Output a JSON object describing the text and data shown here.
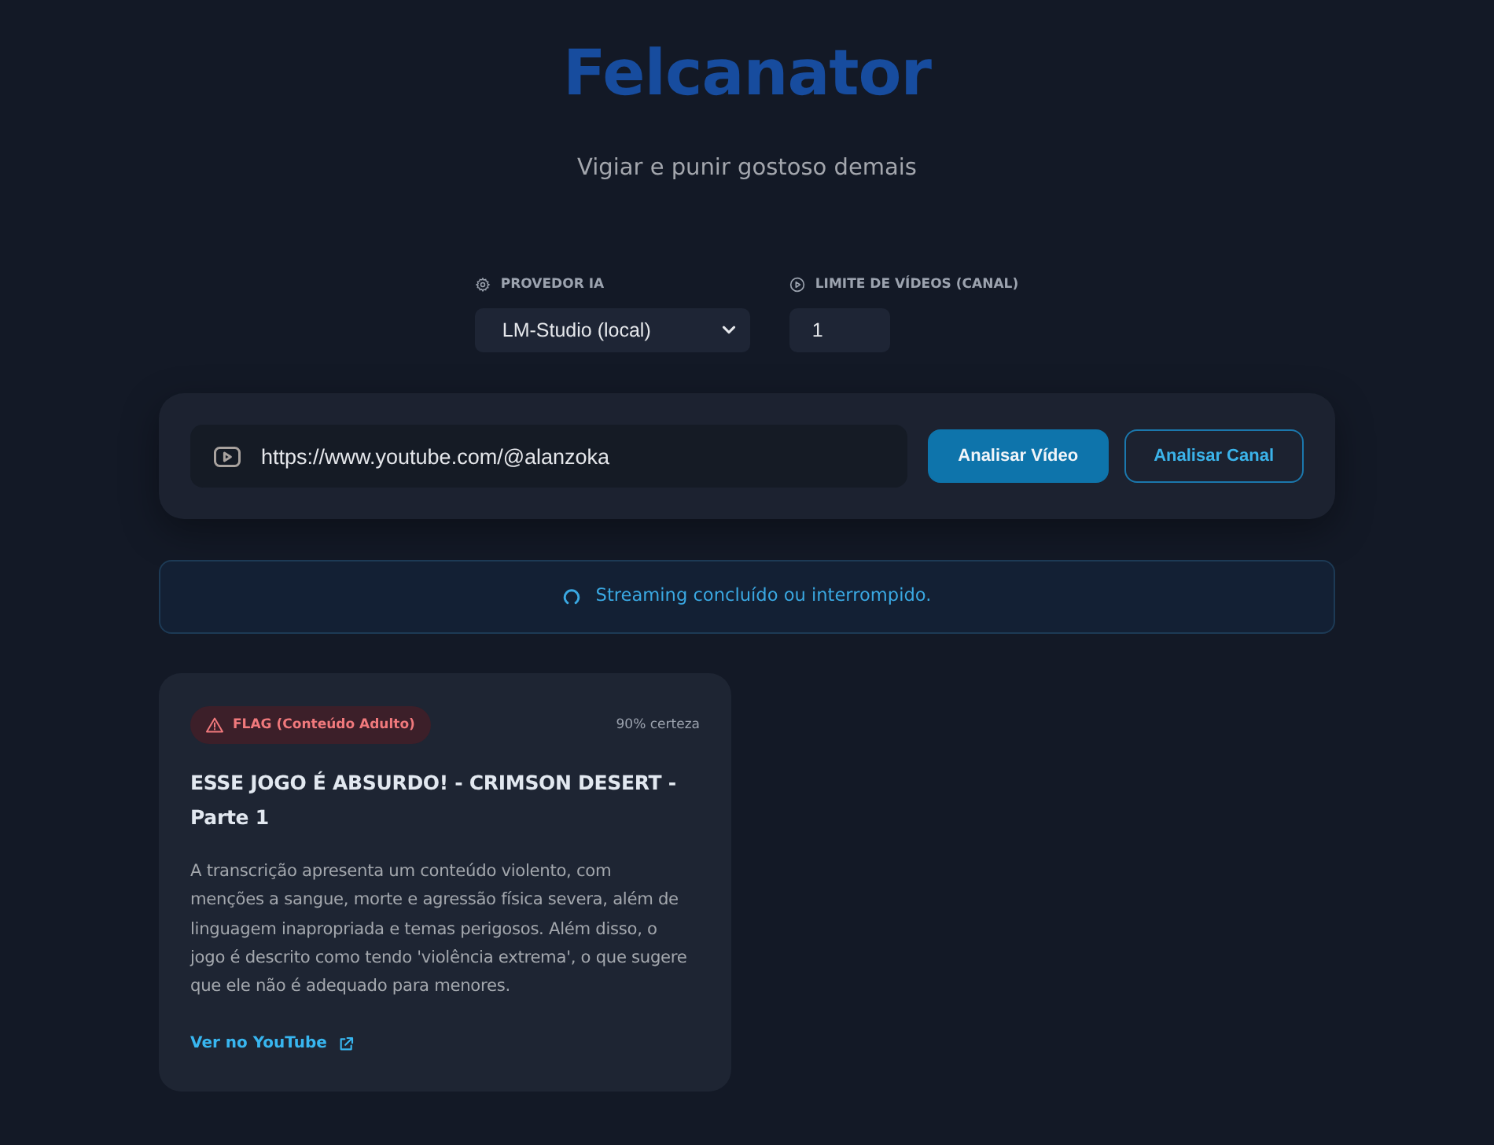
{
  "header": {
    "title": "Felcanator",
    "subtitle": "Vigiar e punir gostoso demais"
  },
  "settings": {
    "provider": {
      "label": "PROVEDOR IA",
      "value": "LM-Studio (local)"
    },
    "video_limit": {
      "label": "LIMITE DE VÍDEOS (CANAL)",
      "value": "1"
    }
  },
  "search": {
    "url": "https://www.youtube.com/@alanzoka",
    "buttons": [
      {
        "label": "Analisar Vídeo",
        "kind": "primary"
      },
      {
        "label": "Analisar Canal",
        "kind": "outline"
      }
    ]
  },
  "status": {
    "text": "Streaming concluído ou interrompido."
  },
  "results": [
    {
      "flag": {
        "label": "FLAG (Conteúdo Adulto)",
        "kind": "danger"
      },
      "confidence": "90% certeza",
      "title": "ESSE JOGO É ABSURDO! - CRIMSON DESERT - Parte 1",
      "description": "A transcrição apresenta um conteúdo violento, com menções a sangue, morte e agressão física severa, além de linguagem inapropriada e temas perigosos. Além disso, o jogo é descrito como tendo 'violência extrema', o que sugere que ele não é adequado para menores.",
      "link": "Ver no YouTube"
    }
  ]
}
